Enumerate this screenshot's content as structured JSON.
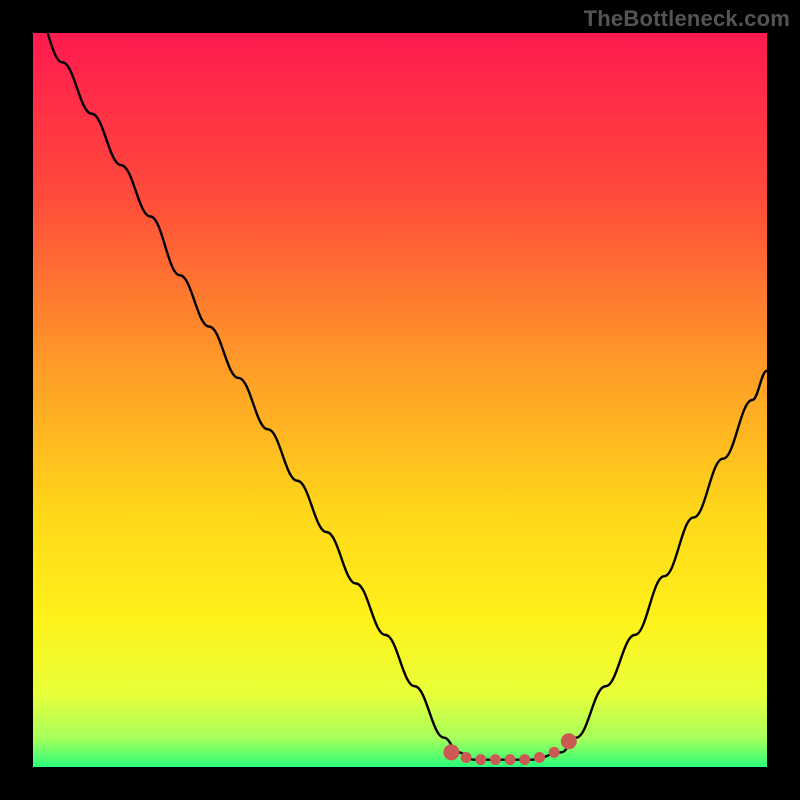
{
  "watermark": "TheBottleneck.com",
  "chart_data": {
    "type": "line",
    "title": "",
    "xlabel": "",
    "ylabel": "",
    "xlim": [
      0,
      100
    ],
    "ylim": [
      0,
      100
    ],
    "series": [
      {
        "name": "bottleneck-curve",
        "x": [
          0,
          4,
          8,
          12,
          16,
          20,
          24,
          28,
          32,
          36,
          40,
          44,
          48,
          52,
          56,
          58,
          60,
          62,
          64,
          68,
          72,
          74,
          78,
          82,
          86,
          90,
          94,
          98,
          100
        ],
        "y": [
          104,
          96,
          89,
          82,
          75,
          67,
          60,
          53,
          46,
          39,
          32,
          25,
          18,
          11,
          4,
          2,
          1,
          1,
          1,
          1,
          2,
          4,
          11,
          18,
          26,
          34,
          42,
          50,
          54
        ]
      },
      {
        "name": "optimal-markers",
        "x": [
          57,
          59,
          61,
          63,
          65,
          67,
          69,
          71,
          73
        ],
        "y": [
          2,
          1.3,
          1,
          1,
          1,
          1,
          1.3,
          2,
          3.5
        ]
      }
    ],
    "gradient_stops": [
      {
        "offset": 0,
        "color": "#ff1a4f"
      },
      {
        "offset": 22,
        "color": "#ff4a3b"
      },
      {
        "offset": 45,
        "color": "#ff9a28"
      },
      {
        "offset": 65,
        "color": "#ffd61a"
      },
      {
        "offset": 80,
        "color": "#fff21a"
      },
      {
        "offset": 90,
        "color": "#e8ff3a"
      },
      {
        "offset": 96,
        "color": "#a8ff5a"
      },
      {
        "offset": 100,
        "color": "#2aff7a"
      }
    ],
    "colors": {
      "curve": "#000000",
      "marker": "#cc5a54",
      "frame": "#000000"
    }
  }
}
